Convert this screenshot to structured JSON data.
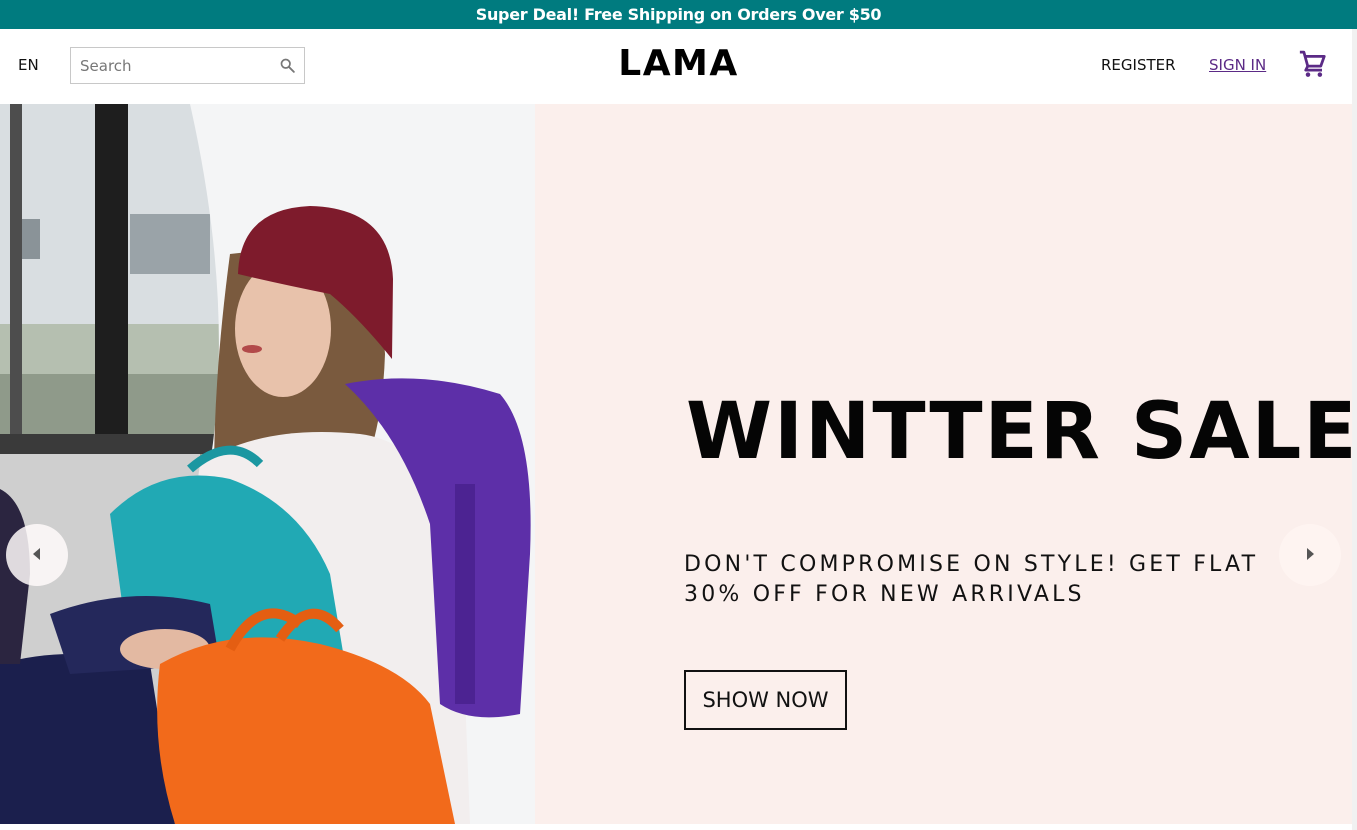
{
  "announcement": {
    "text": "Super Deal! Free Shipping on Orders Over $50"
  },
  "navbar": {
    "language": "EN",
    "search": {
      "placeholder": "Search",
      "value": ""
    },
    "logo": "LAMA",
    "menu": {
      "register": "REGISTER",
      "sign_in": "SIGN IN"
    },
    "cart_icon": "shopping-cart-icon"
  },
  "slider": {
    "title": "WINTTER SALE",
    "description": "DON'T COMPROMISE ON STYLE! GET FLAT 30% OFF FOR NEW ARRIVALS",
    "button_label": "SHOW NOW",
    "image_subject": "woman in maroon beanie with colorful backpacks",
    "left_arrow_icon": "arrow-left-icon",
    "right_arrow_icon": "arrow-right-icon"
  },
  "colors": {
    "announcement_bg": "#007b7f",
    "slide_bg": "#fbefec",
    "accent": "#5b2a86"
  }
}
